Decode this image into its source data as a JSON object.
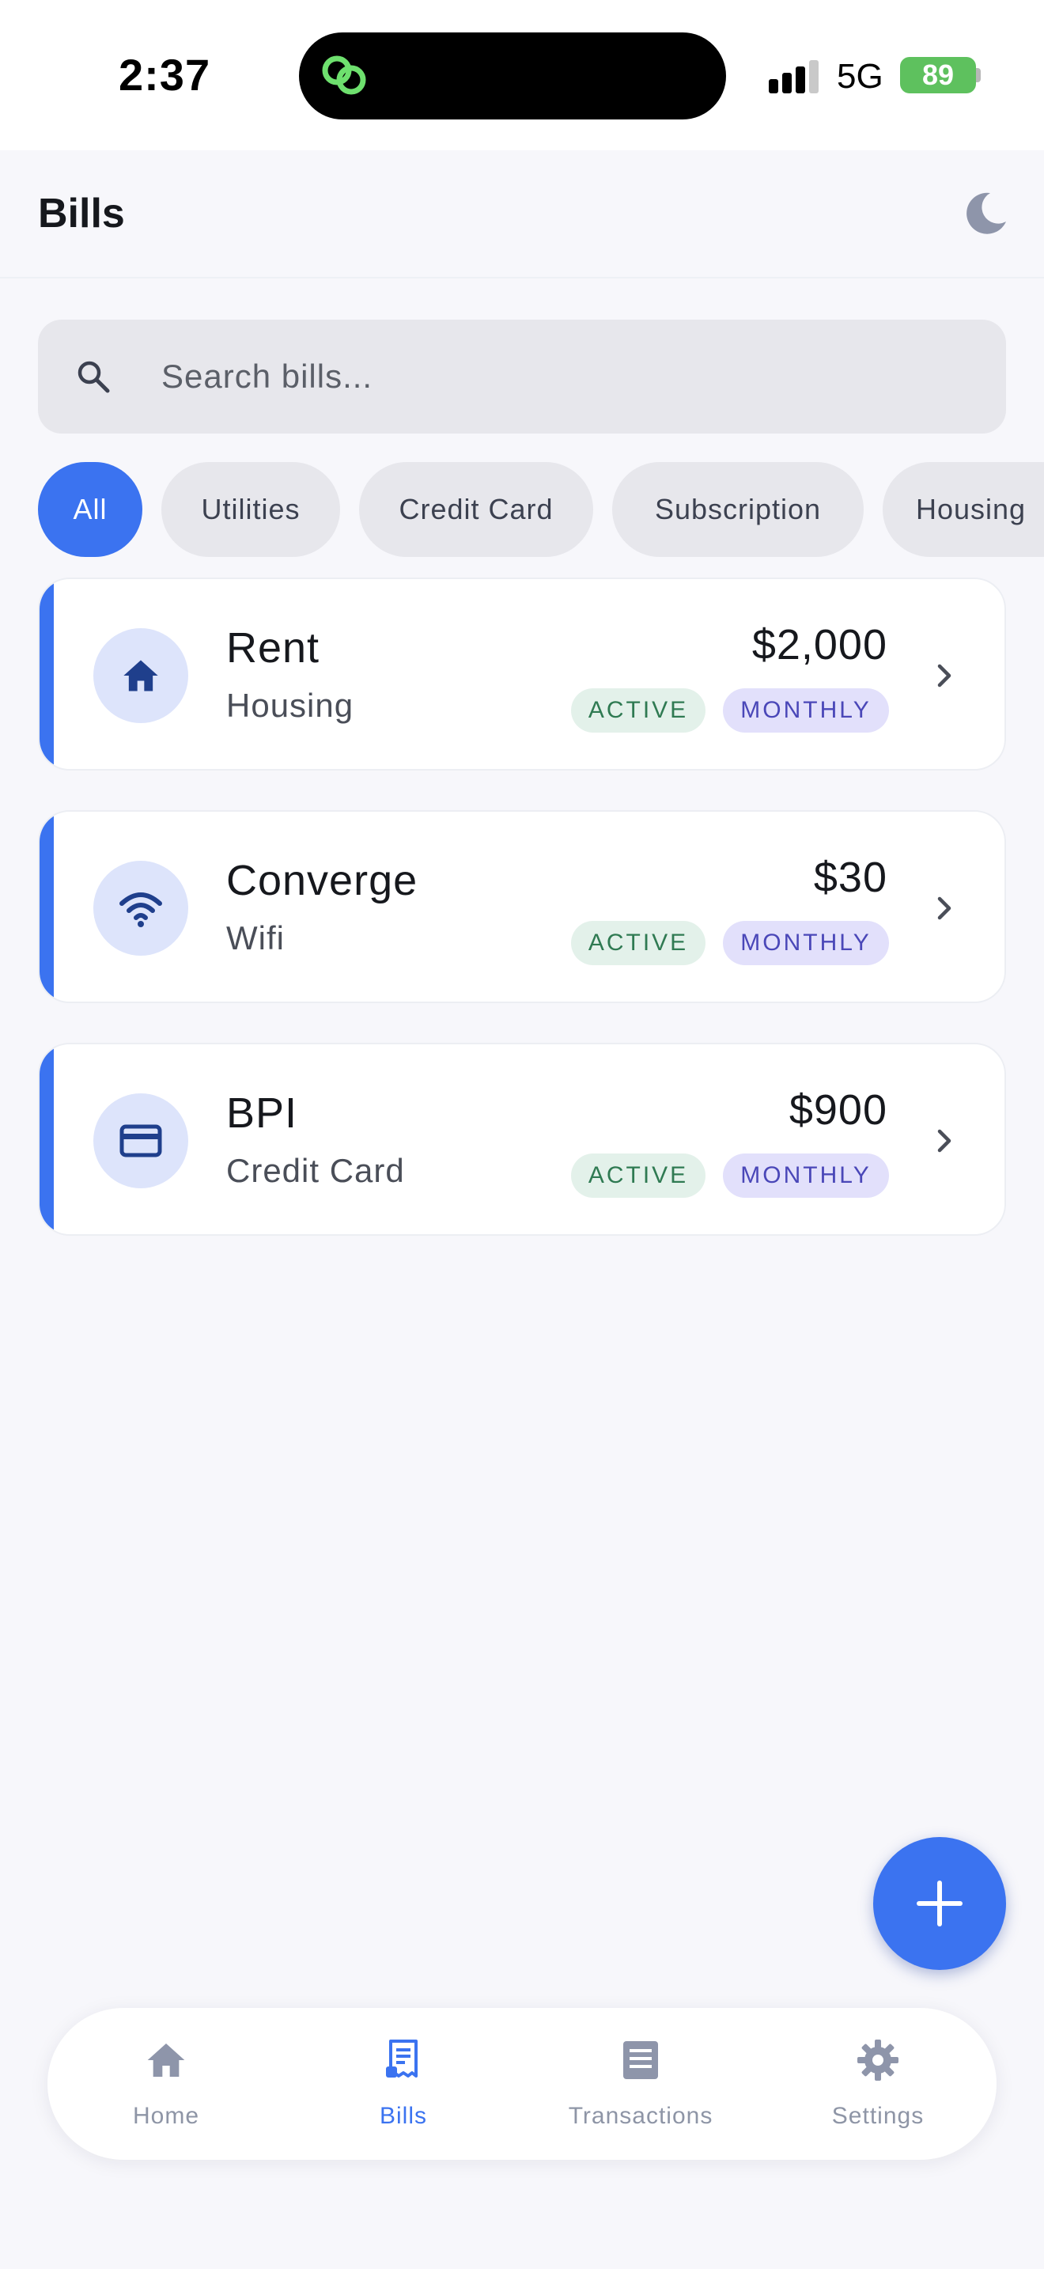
{
  "status_bar": {
    "time": "2:37",
    "network": "5G",
    "battery": "89"
  },
  "header": {
    "title": "Bills",
    "theme_icon": "moon-icon"
  },
  "search": {
    "placeholder": "Search bills...",
    "value": ""
  },
  "filters": [
    {
      "label": "All",
      "active": true
    },
    {
      "label": "Utilities",
      "active": false
    },
    {
      "label": "Credit Card",
      "active": false
    },
    {
      "label": "Subscription",
      "active": false
    },
    {
      "label": "Housing",
      "active": false
    }
  ],
  "bills": [
    {
      "name": "Rent",
      "category": "Housing",
      "amount": "$2,000",
      "status": "ACTIVE",
      "frequency": "MONTHLY",
      "icon": "home-icon"
    },
    {
      "name": "Converge",
      "category": "Wifi",
      "amount": "$30",
      "status": "ACTIVE",
      "frequency": "MONTHLY",
      "icon": "wifi-icon"
    },
    {
      "name": "BPI",
      "category": "Credit Card",
      "amount": "$900",
      "status": "ACTIVE",
      "frequency": "MONTHLY",
      "icon": "credit-card-icon"
    }
  ],
  "fab": {
    "icon": "plus-icon"
  },
  "bottom_nav": [
    {
      "label": "Home",
      "icon": "home-icon",
      "active": false
    },
    {
      "label": "Bills",
      "icon": "receipt-icon",
      "active": true
    },
    {
      "label": "Transactions",
      "icon": "list-icon",
      "active": false
    },
    {
      "label": "Settings",
      "icon": "gear-icon",
      "active": false
    }
  ],
  "colors": {
    "accent": "#3b73f0",
    "background": "#f7f7fb",
    "active_badge_bg": "#e3f1ea",
    "active_badge_text": "#2f7a52",
    "frequency_badge_bg": "#e2e0fb",
    "frequency_badge_text": "#4a47b8",
    "battery": "#5ec15e"
  }
}
